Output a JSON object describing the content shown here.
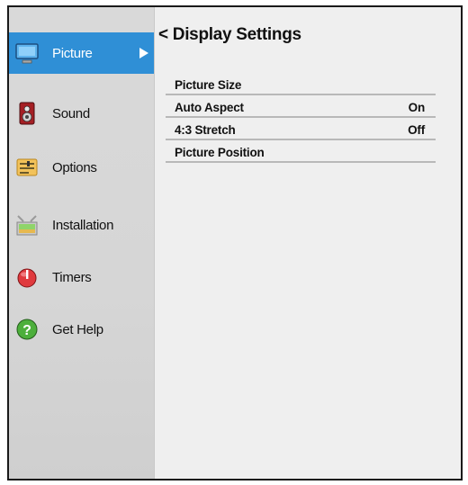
{
  "sidebar": {
    "items": [
      {
        "label": "Picture",
        "icon": "monitor-icon"
      },
      {
        "label": "Sound",
        "icon": "speaker-icon"
      },
      {
        "label": "Options",
        "icon": "options-icon"
      },
      {
        "label": "Installation",
        "icon": "installation-icon"
      },
      {
        "label": "Timers",
        "icon": "timer-icon"
      },
      {
        "label": "Get Help",
        "icon": "help-icon"
      }
    ],
    "active_index": 0
  },
  "main": {
    "title": "< Display Settings",
    "rows": [
      {
        "label": "Picture Size",
        "value": ""
      },
      {
        "label": "Auto Aspect",
        "value": "On"
      },
      {
        "label": "4:3 Stretch",
        "value": "Off"
      },
      {
        "label": "Picture Position",
        "value": ""
      }
    ]
  },
  "colors": {
    "accent": "#2f8fd6",
    "sidebar_bg": "#d9d9d9",
    "main_bg": "#efefef"
  }
}
